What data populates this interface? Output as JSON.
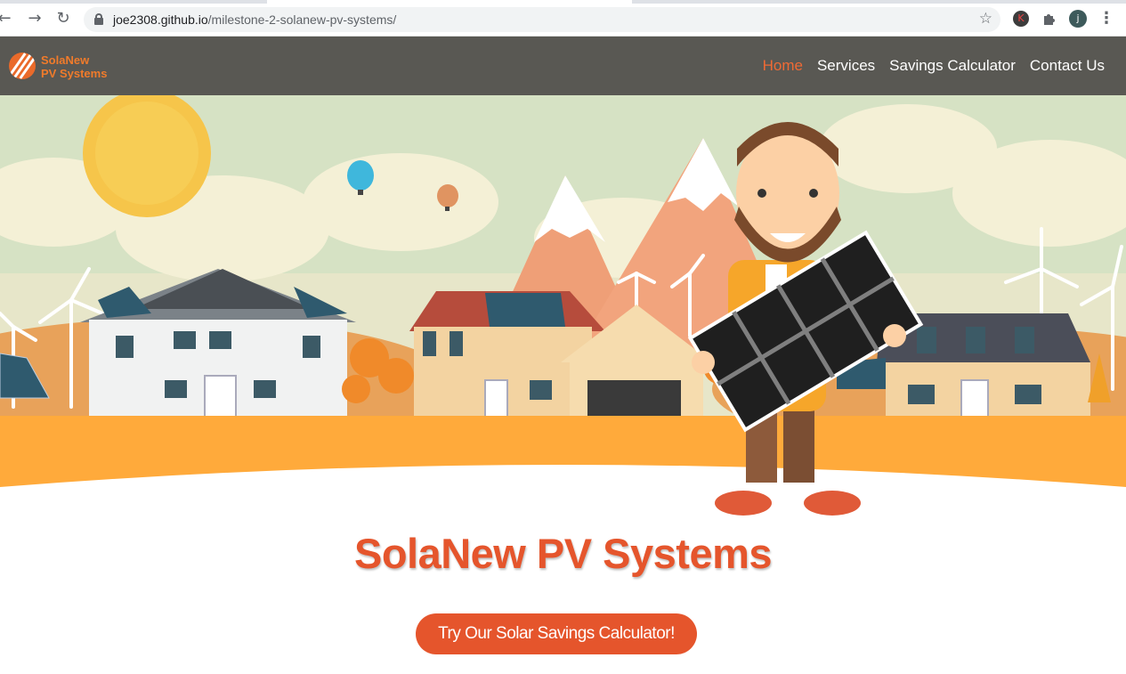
{
  "browser": {
    "url_host": "joe2308.github.io",
    "url_path": "/milestone-2-solanew-pv-systems/",
    "extensions": [
      {
        "icon": "k-extension-icon",
        "letter": "K",
        "color": "#3c3c3c"
      },
      {
        "icon": "puzzle-icon"
      },
      {
        "icon": "profile-avatar",
        "letter": "j",
        "color": "#3d5a5b"
      }
    ]
  },
  "site": {
    "logo": {
      "line1": "SolaNew",
      "line2": "PV Systems"
    },
    "nav": [
      {
        "label": "Home",
        "active": true
      },
      {
        "label": "Services",
        "active": false
      },
      {
        "label": "Savings Calculator",
        "active": false
      },
      {
        "label": "Contact Us",
        "active": false
      }
    ],
    "title": "SolaNew PV Systems",
    "cta": "Try Our Solar Savings Calculator!"
  },
  "colors": {
    "nav_bg": "#595853",
    "accent": "#e5552c",
    "active_link": "#ef6a35"
  }
}
